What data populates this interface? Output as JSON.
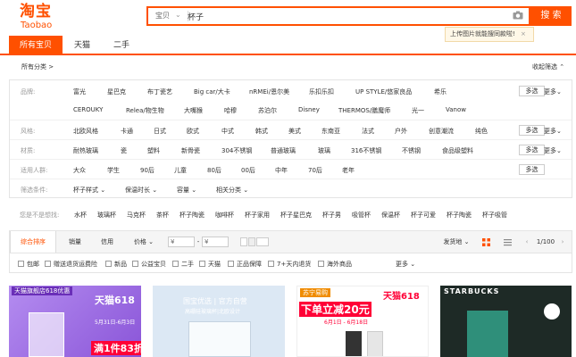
{
  "logo": {
    "cn": "淘宝",
    "en": "Taobao"
  },
  "search": {
    "scope": "宝贝",
    "query": "杯子",
    "button": "搜 索",
    "tooltip": "上传图片就能搜同款啦!",
    "tooltip_close": "×"
  },
  "tabs": [
    {
      "label": "所有宝贝"
    },
    {
      "label": "天猫"
    },
    {
      "label": "二手"
    }
  ],
  "breadcrumb": "所有分类 >",
  "collapse": "收起筛选 ⌃",
  "attributes": {
    "brand": {
      "label": "品牌:",
      "row1": [
        "富光",
        "星巴克",
        "布丁瓷艺",
        "Big car/大卡",
        "nRMEi/恩尔美",
        "乐扣乐扣",
        "UP STYLE/悠家良品",
        "希乐"
      ],
      "row2": [
        "CEROUKY",
        "Relea/物生物",
        "大嘴猴",
        "哈穆",
        "苏泊尔",
        "Disney",
        "THERMOS/膳魔师",
        "光一",
        "Vanow"
      ]
    },
    "style": {
      "label": "风格:",
      "options": [
        "北欧风格",
        "卡通",
        "日式",
        "欧式",
        "中式",
        "韩式",
        "美式",
        "东南亚",
        "法式",
        "户外",
        "创意潮流",
        "纯色"
      ]
    },
    "material": {
      "label": "材质:",
      "options": [
        "耐热玻璃",
        "瓷",
        "塑料",
        "新骨瓷",
        "304不锈钢",
        "普通玻璃",
        "玻璃",
        "316不锈钢",
        "不锈钢",
        "食品级塑料"
      ]
    },
    "crowd": {
      "label": "适用人群:",
      "options": [
        "大众",
        "学生",
        "90后",
        "儿童",
        "80后",
        "00后",
        "中年",
        "70后",
        "老年"
      ]
    },
    "conditions": {
      "label": "筛选条件:",
      "options": [
        "杯子样式",
        "保温时长",
        "容量",
        "相关分类"
      ]
    },
    "multi": "多选",
    "more": "更多⌄"
  },
  "guess": {
    "label": "您是不是想找:",
    "words": [
      "水杯",
      "玻璃杯",
      "马克杯",
      "茶杯",
      "杯子陶瓷",
      "咖啡杯",
      "杯子家用",
      "杯子星巴克",
      "杯子男",
      "吸管杯",
      "保温杯",
      "杯子可爱",
      "杯子陶瓷",
      "杯子吸管"
    ]
  },
  "sort": {
    "items": [
      "综合排序",
      "销量",
      "信用",
      "价格"
    ],
    "price_from": "¥",
    "price_to": "¥",
    "dash": "-",
    "ship": "发货地",
    "page": "1/100"
  },
  "filters": [
    "包邮",
    "赠送退货运费险",
    "新品",
    "公益宝贝",
    "二手",
    "天猫",
    "正品保障",
    "7+天内退货",
    "海外商品"
  ],
  "filters_more": "更多",
  "cards": [
    {
      "tag": "天猫旗舰店618优惠",
      "badge": "天猫618",
      "date": "5月31日-6月3日",
      "promo": "满1件83折"
    },
    {
      "tag": "国宝优选 | 官方自营",
      "sub": "高硼硅玻璃杯|北欧设计"
    },
    {
      "tag": "苏宁易购",
      "badge": "天猫618",
      "promo": "下单立减20元",
      "date": "6月1日 - 6月18日"
    },
    {
      "tag": "STARBUCKS",
      "badge": "STARBUCKS"
    }
  ],
  "colors": {
    "accent": "#ff5000",
    "tmall_red": "#ff0036"
  }
}
